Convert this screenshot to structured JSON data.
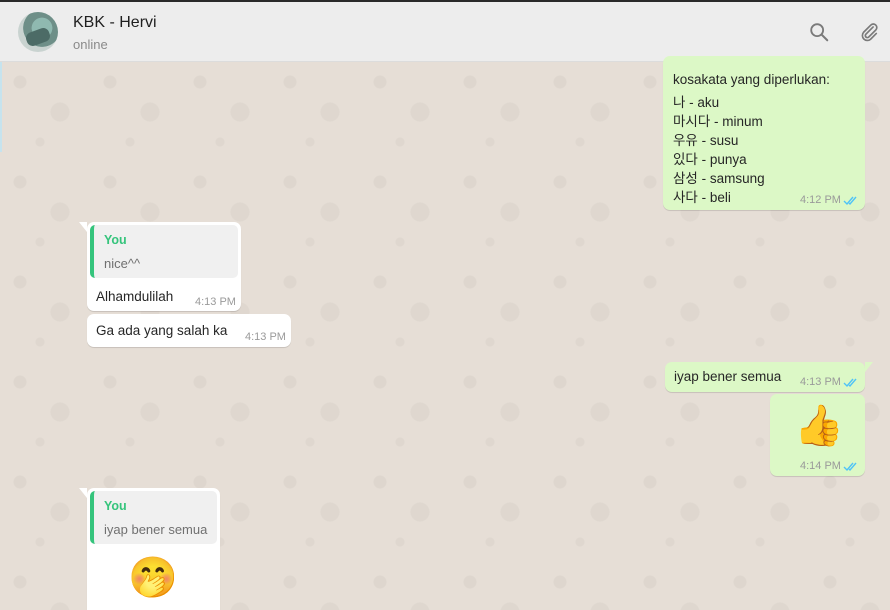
{
  "header": {
    "contact_name": "KBK - Hervi",
    "status": "online",
    "icons": [
      "search-icon",
      "attach-icon"
    ]
  },
  "messages": {
    "vocab": {
      "lines": [
        "kosakata yang diperlukan:",
        "나 - aku",
        "마시다 - minum",
        "우유 - susu",
        "있다 - punya",
        "삼성 - samsung",
        "사다 - beli"
      ],
      "time": "4:12 PM"
    },
    "reply1": {
      "quote_author": "You",
      "quote_text": "nice^^",
      "text": "Alhamdulilah",
      "time": "4:13 PM"
    },
    "msg2": {
      "text": "Ga ada yang salah ka",
      "time": "4:13 PM"
    },
    "msg3": {
      "text": "iyap bener semua",
      "time": "4:13 PM"
    },
    "msg4": {
      "emoji": "👍",
      "time": "4:14 PM"
    },
    "reply2": {
      "quote_author": "You",
      "quote_text": "iyap bener semua",
      "emoji": "🤭"
    }
  },
  "colors": {
    "chat_bg": "#e5ddd5",
    "incoming": "#ffffff",
    "outgoing": "#dcf8c6",
    "quote_accent": "#35c47c",
    "read_ticks": "#4fc3f7"
  }
}
